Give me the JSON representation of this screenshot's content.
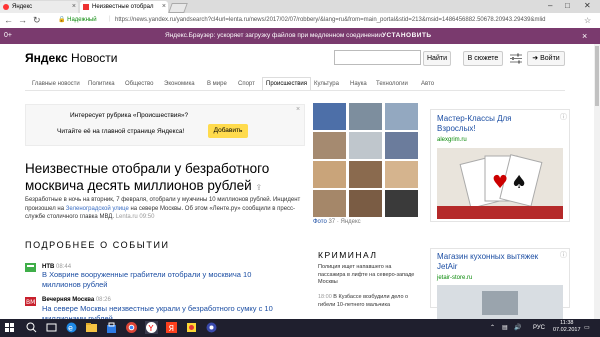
{
  "browser": {
    "tabs": [
      {
        "label": "Яндекс",
        "active": false
      },
      {
        "label": "Неизвестные отобрал",
        "active": true
      }
    ],
    "window_controls": [
      "–",
      "□",
      "✕"
    ],
    "secure_label": "Надежный",
    "url": "https://news.yandex.ru/yandsearch?cl4url=lenta.ru/news/2017/02/07/robbery/&lang=ru&from=main_portal&stid=213&msid=1486456882.50678.20943.29439&mlid"
  },
  "promo": {
    "left": "0+",
    "text": "Яндекс.Браузер: ускоряет загрузку файлов при медленном соединении",
    "button": "УСТАНОВИТЬ",
    "close": "×"
  },
  "header": {
    "logo_ya": "Яндекс",
    "logo_news": "Новости",
    "search_placeholder": "",
    "find_button": "Найти",
    "plot_button": "В сюжете",
    "login_button": "Войти"
  },
  "categories": [
    "Главные новости",
    "Политика",
    "Общество",
    "Экономика",
    "В мире",
    "Спорт",
    "Происшествия",
    "Культура",
    "Наука",
    "Технологии",
    "Авто"
  ],
  "active_category": "Происшествия",
  "rubric": {
    "title": "Интересует рубрика «Происшествия»?",
    "subtitle": "Читайте её на главной странице Яндекса!",
    "button": "Добавить",
    "close": "×"
  },
  "article": {
    "headline": "Неизвестные отобрали у безработного москвича десять миллионов рублей",
    "body_pre": "Безработные в ночь на вторник, 7 февраля, отобрали у мужчины 10 миллионов рублей. Инцидент произошел на ",
    "body_link": "Зеленоградской улице",
    "body_post": " на севере Москвы. Об этом «Ленте.ру» сообщили в пресс-службе столичного главка МВД.",
    "source": "Lenta.ru",
    "time": "09:50"
  },
  "related": {
    "heading": "ПОДРОБНЕЕ О СОБЫТИИ",
    "items": [
      {
        "source": "НТВ",
        "time": "08:44",
        "title": "В Ховрине вооруженные грабители отобрали у москвича 10 миллионов рублей",
        "color": "#3fae49"
      },
      {
        "source": "Вечерняя Москва",
        "time": "08:26",
        "title": "На севере Москвы неизвестные украли у безработного сумку с 10 миллионами рублей",
        "color": "#c8202c"
      }
    ]
  },
  "photos": {
    "caption": "Фото",
    "count": "37",
    "source": "Яндекс"
  },
  "criminal": {
    "heading": "КРИМИНАЛ",
    "items": [
      {
        "text": "Полиция ищет напавшего на пассажира в лифте на северо-западе Москвы",
        "time": ""
      },
      {
        "text": "В Кузбассе возбудили дело о гибели 10-летнего мальчика",
        "time": "18:00"
      }
    ]
  },
  "ads": [
    {
      "title": "Мастер-Классы Для Взрослых!",
      "url": "alexgrim.ru"
    },
    {
      "title": "Магазин кухонных вытяжек JetAir",
      "url": "jetair-store.ru"
    }
  ],
  "taskbar": {
    "time": "11:38",
    "date": "07.02.2017",
    "lang": "РУС"
  }
}
